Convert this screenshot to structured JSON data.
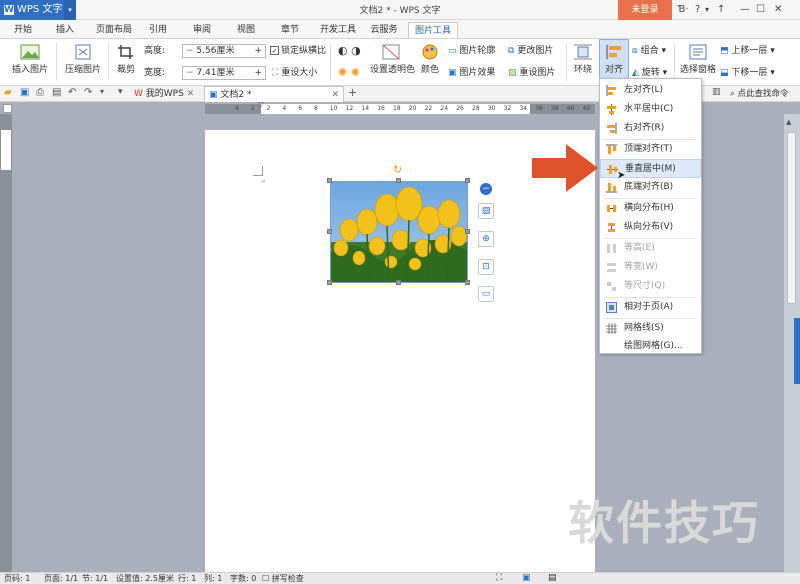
{
  "app": {
    "name": "WPS 文字",
    "doc_title": "文档2 * - WPS 文字",
    "login": "未登录",
    "help": "?"
  },
  "tabs": [
    "开始",
    "插入",
    "页面布局",
    "引用",
    "审阅",
    "视图",
    "章节",
    "开发工具",
    "云服务",
    "图片工具"
  ],
  "ribbon": {
    "insert_picture": "插入图片",
    "compress": "压缩图片",
    "crop": "裁剪",
    "height_label": "高度:",
    "height_value": "5.56厘米",
    "width_label": "宽度:",
    "width_value": "7.41厘米",
    "lock_ratio": "锁定纵横比",
    "reset_size": "重设大小",
    "transparency": "设置透明色",
    "color": "颜色",
    "picture_outline": "图片轮廓",
    "picture_effect": "图片效果",
    "change_picture": "更改图片",
    "reset_picture": "重设图片",
    "wrap": "环绕",
    "align": "对齐",
    "group": "组合",
    "rotate": "旋转",
    "selection_pane": "选择窗格",
    "bring_forward": "上移一层",
    "send_backward": "下移一层"
  },
  "quickbar": {
    "tab_mywps": "我的WPS",
    "tab_doc": "文档2 *",
    "search": "点此查找命令"
  },
  "ruler_ticks": [
    "4",
    "2",
    "2",
    "4",
    "6",
    "8",
    "10",
    "12",
    "14",
    "16",
    "18",
    "20",
    "22",
    "24",
    "26",
    "28",
    "30",
    "32",
    "34",
    "36",
    "38",
    "40",
    "42",
    "44"
  ],
  "align_menu": [
    {
      "label": "左对齐(L)",
      "enabled": true
    },
    {
      "label": "水平居中(C)",
      "enabled": true
    },
    {
      "label": "右对齐(R)",
      "enabled": true
    },
    {
      "label": "顶端对齐(T)",
      "enabled": true
    },
    {
      "label": "垂直居中(M)",
      "enabled": true,
      "highlight": true
    },
    {
      "label": "底端对齐(B)",
      "enabled": true
    },
    {
      "label": "横向分布(H)",
      "enabled": true
    },
    {
      "label": "纵向分布(V)",
      "enabled": true
    },
    {
      "label": "等高(E)",
      "enabled": false
    },
    {
      "label": "等宽(W)",
      "enabled": false
    },
    {
      "label": "等尺寸(Q)",
      "enabled": false
    },
    {
      "label": "相对于页(A)",
      "enabled": true
    },
    {
      "label": "网格线(S)",
      "enabled": true
    },
    {
      "label": "绘图网格(G)...",
      "enabled": true
    }
  ],
  "status": {
    "page_code": "页码: 1",
    "pages": "页面: 1/1",
    "section": "节: 1/1",
    "setting": "设置值: 2.5厘米",
    "row": "行: 1",
    "col": "列: 1",
    "words": "字数: 0",
    "spell": "拼写检查"
  },
  "watermark": "软件技巧",
  "colors": {
    "accent": "#2f6fc4",
    "login": "#e8704a",
    "arrow": "#e0522a"
  }
}
